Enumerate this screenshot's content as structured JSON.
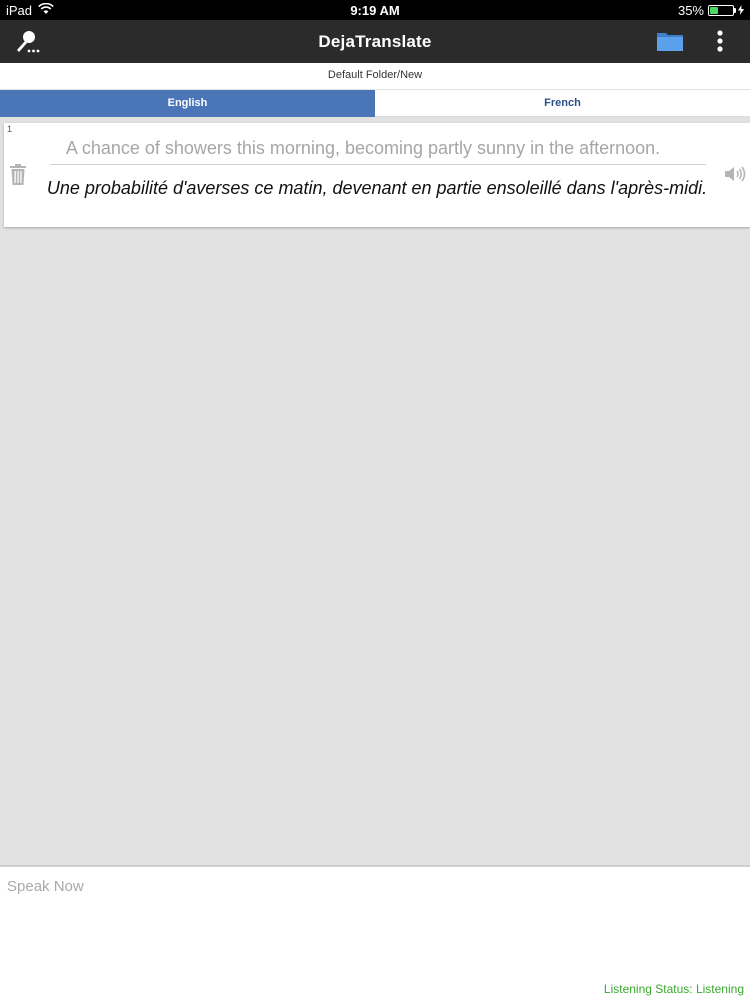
{
  "status_bar": {
    "device": "iPad",
    "time": "9:19 AM",
    "battery_percent": "35%",
    "battery_level": 0.35
  },
  "app_bar": {
    "title": "DejaTranslate",
    "icons": [
      "microphone-icon",
      "folder-icon",
      "more-vertical-icon"
    ],
    "background": "#2b2b2b",
    "folder_color": "#4a90e2"
  },
  "folder_path": "Default Folder/New",
  "tabs": [
    {
      "label": "English",
      "active": true
    },
    {
      "label": "French",
      "active": false
    }
  ],
  "accent_color": "#4a76b8",
  "entries": [
    {
      "number": "1",
      "source": "A chance of showers this morning, becoming partly sunny in the afternoon.",
      "translation": "Une probabilité d'averses ce matin, devenant en partie ensoleillé dans l'après-midi."
    }
  ],
  "input": {
    "placeholder": "Speak Now",
    "value": ""
  },
  "listening_status": "Listening Status: Listening",
  "listening_color": "#3aa82f"
}
